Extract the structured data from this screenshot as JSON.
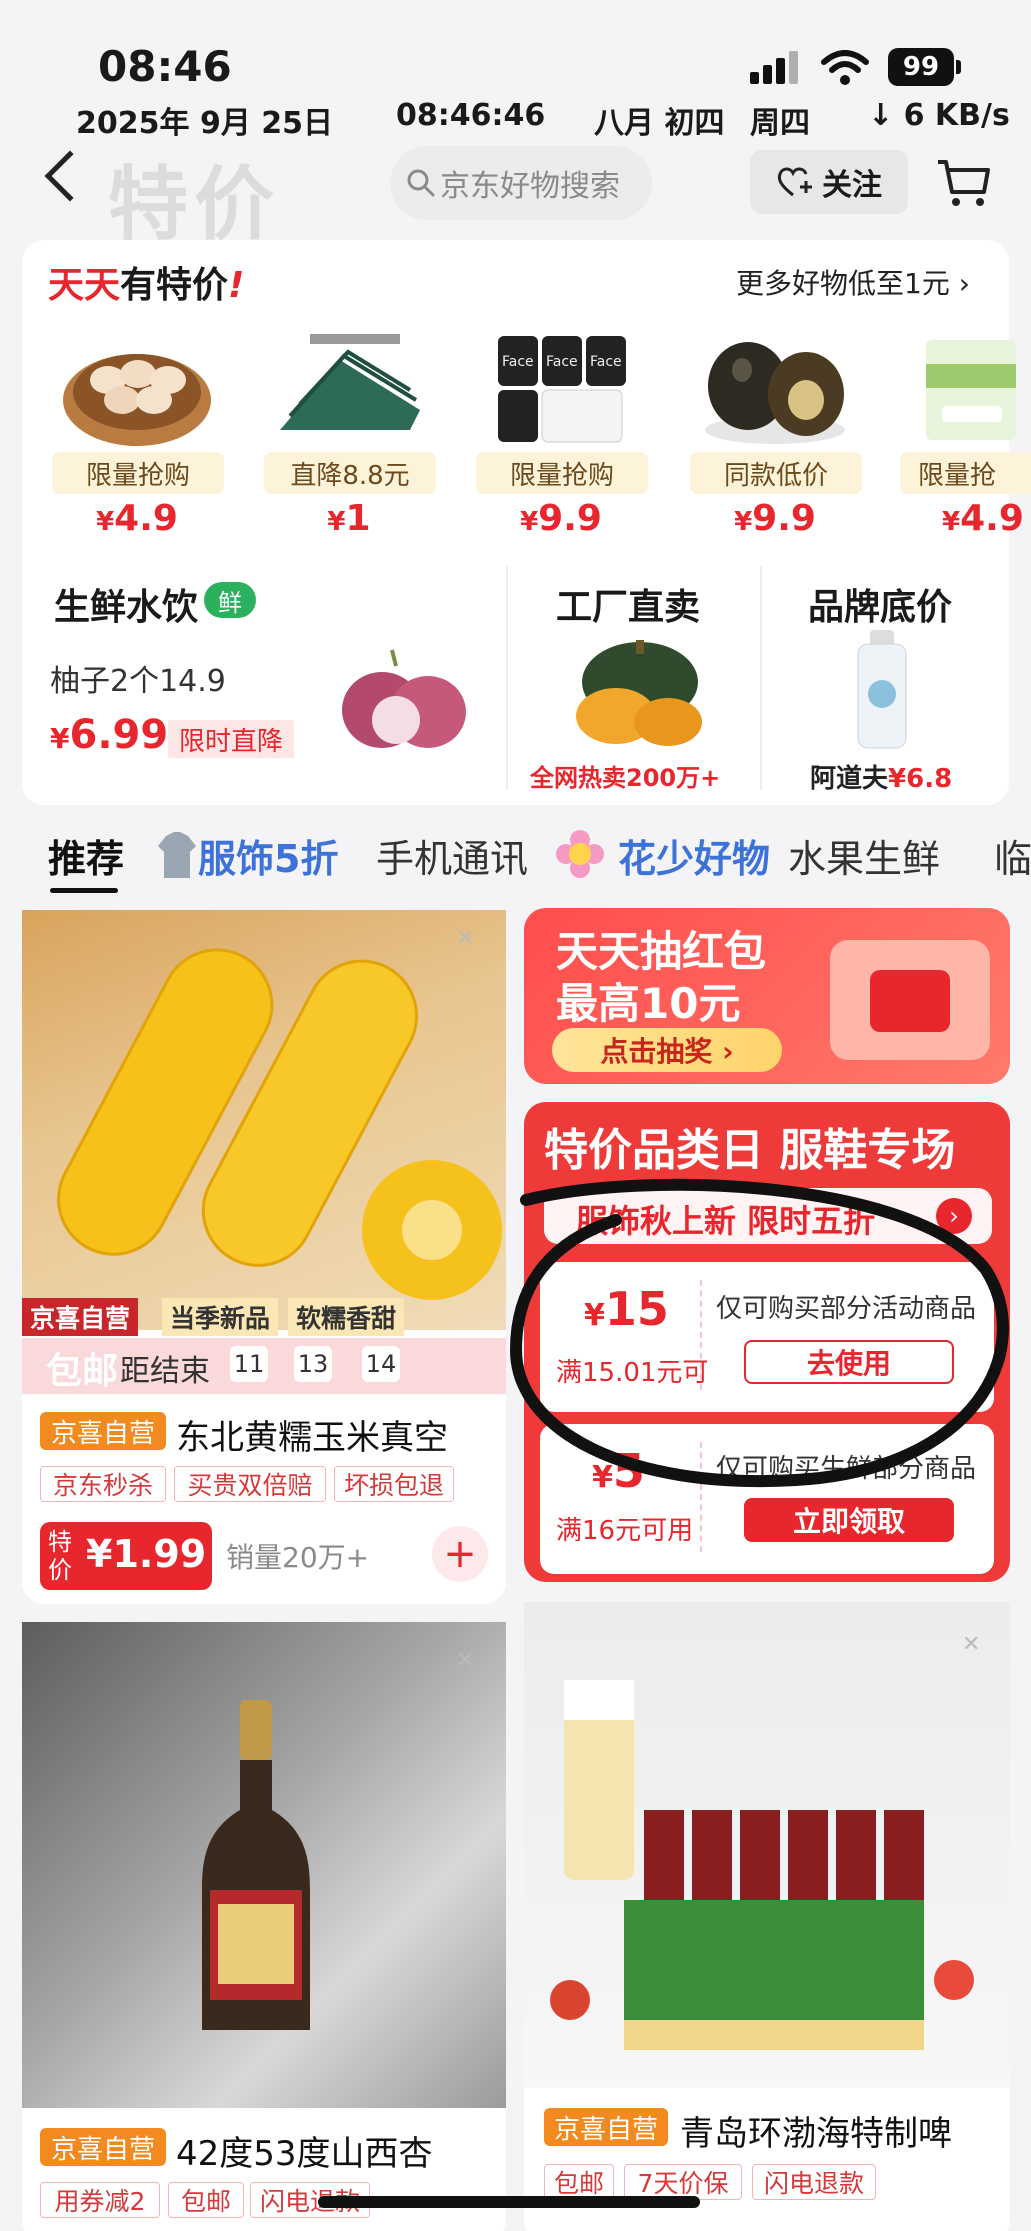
{
  "status_bar": {
    "time": "08:46",
    "battery": "99",
    "date": "2025年 9月 25日",
    "clock": "08:46:46",
    "lunar": "八月 初四",
    "weekday": "周四",
    "speed": "↓ 6 KB/s"
  },
  "header": {
    "title": "特价",
    "search_placeholder": "京东好物搜索",
    "follow_label": "关注"
  },
  "daily_deals": {
    "title_red": "天天",
    "title_black": "有特价",
    "more_label": "更多好物低至1元",
    "items": [
      {
        "tag": "限量抢购",
        "currency": "¥",
        "price": "4.9",
        "image": "eggs-icon"
      },
      {
        "tag": "直降8.8元",
        "currency": "¥",
        "price": "1",
        "image": "hangers-icon"
      },
      {
        "tag": "限量抢购",
        "currency": "¥",
        "price": "9.9",
        "image": "tissue-icon"
      },
      {
        "tag": "同款低价",
        "currency": "¥",
        "price": "9.9",
        "image": "preserved-egg-icon"
      },
      {
        "tag": "限量抢",
        "currency": "¥",
        "price": "4.9",
        "image": "napkin-icon"
      }
    ]
  },
  "fresh": {
    "title": "生鲜水饮",
    "badge": "鲜",
    "subtitle": "柚子2个14.9",
    "currency": "¥",
    "price": "6.99",
    "tag": "限时直降"
  },
  "factory": {
    "title": "工厂直卖",
    "subtitle": "全网热卖200万+"
  },
  "brand": {
    "title": "品牌底价",
    "subtitle_name": "阿道夫",
    "subtitle_price": "¥6.8"
  },
  "tabs": [
    "推荐",
    "服饰5折",
    "手机通讯",
    "花少好物",
    "水果生鲜",
    "临"
  ],
  "corn_product": {
    "ribbon_1": "京喜自营",
    "ribbon_2": "当季新品",
    "ribbon_3": "软糯香甜",
    "overlay_text": "包邮",
    "countdown_label": "距结束",
    "countdown": [
      "11",
      "13",
      "14"
    ],
    "badge": "京喜自营",
    "name": "东北黄糯玉米真空",
    "tags": [
      "京东秒杀",
      "买贵双倍赔",
      "坏损包退"
    ],
    "special_label": "特价",
    "price": "¥1.99",
    "sold": "销量20万+",
    "add_label": "+"
  },
  "lottery": {
    "line1": "天天抽红包",
    "line2": "最高10元",
    "button": "点击抽奖 ›"
  },
  "category_day": {
    "title": "特价品类日 服鞋专场",
    "subtitle": "服饰秋上新 限时五折",
    "coupons": [
      {
        "currency": "¥",
        "amount": "15",
        "condition": "满15.01元可",
        "desc": "仅可购买部分活动商品",
        "button": "去使用"
      },
      {
        "currency": "¥",
        "amount": "5",
        "condition": "满16元可用",
        "desc": "仅可购买生鲜部分商品",
        "button": "立即领取"
      }
    ]
  },
  "liquor_product": {
    "badge": "京喜自营",
    "name": "42度53度山西杏",
    "tags": [
      "用券减2",
      "包邮",
      "闪电退款"
    ]
  },
  "beer_product": {
    "badge": "京喜自营",
    "name": "青岛环渤海特制啤",
    "tags": [
      "包邮",
      "7天价保",
      "闪电退款"
    ]
  },
  "colors": {
    "accent_red": "#e8262d",
    "fresh_green": "#2bb15e",
    "tab_blue": "#3d73d9",
    "jx_orange": "#f28a1f"
  }
}
